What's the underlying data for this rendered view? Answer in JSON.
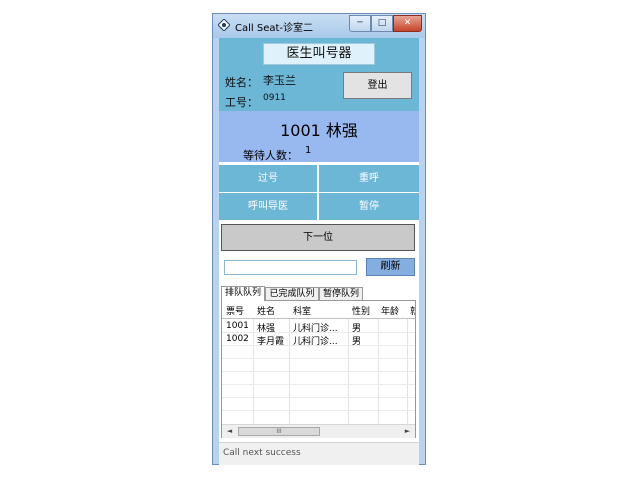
{
  "window": {
    "title": "Call Seat-诊室二",
    "min_glyph": "─",
    "max_glyph": "□",
    "close_glyph": "✕"
  },
  "header": {
    "app_title": "医生叫号器",
    "name_label": "姓名：",
    "name_value": "李玉兰",
    "id_label": "工号：",
    "id_value": "0911",
    "logout_label": "登出"
  },
  "call": {
    "current": "1001 林强",
    "waiting_label": "等待人数：",
    "waiting_count": "1"
  },
  "actions": {
    "pass": "过号",
    "recall": "重呼",
    "call_guide": "呼叫导医",
    "pause": "暂停",
    "next": "下一位",
    "refresh": "刷新"
  },
  "search": {
    "value": "",
    "placeholder": ""
  },
  "tabs": [
    {
      "label": "排队队列",
      "active": true
    },
    {
      "label": "已完成队列",
      "active": false
    },
    {
      "label": "暂停队列",
      "active": false
    }
  ],
  "table": {
    "columns": [
      "票号",
      "姓名",
      "科室",
      "性别",
      "年龄",
      "就"
    ],
    "rows": [
      [
        "1001",
        "林强",
        "儿科门诊...",
        "男",
        "",
        ""
      ],
      [
        "1002",
        "李月霞",
        "儿科门诊...",
        "男",
        "",
        ""
      ]
    ]
  },
  "scrollbar": {
    "left": "◄",
    "right": "►",
    "grip": "III"
  },
  "status": {
    "text": "Call next success"
  },
  "colors": {
    "panel_blue": "#6cb6d6",
    "call_panel": "#98b8f0",
    "window_frame": "#b7d3ef"
  }
}
